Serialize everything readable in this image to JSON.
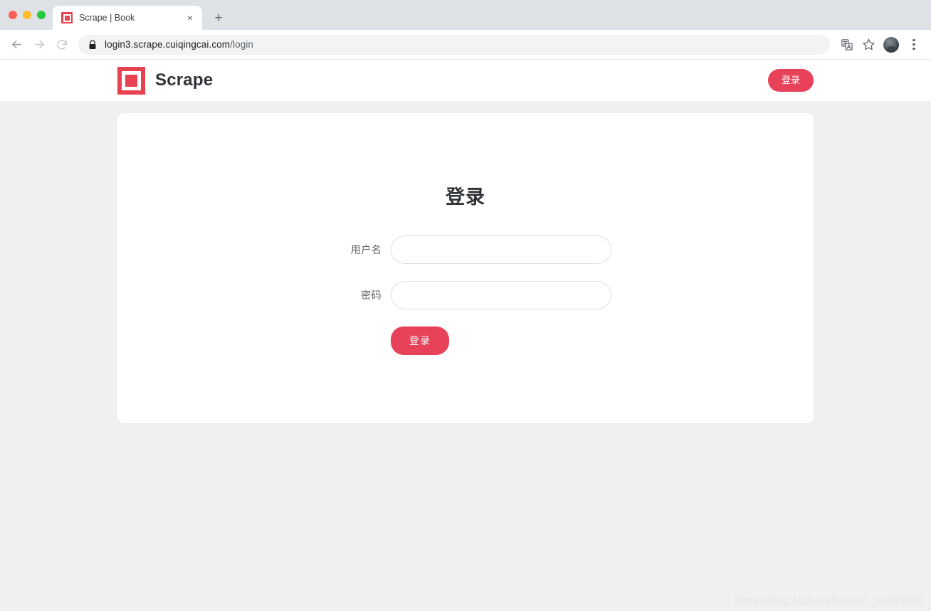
{
  "browser": {
    "window_controls": [
      "close",
      "minimize",
      "maximize"
    ],
    "tab": {
      "title": "Scrape | Book",
      "favicon": "scrape-logo-icon",
      "close_label": "×"
    },
    "new_tab_label": "+",
    "nav": {
      "back": "back-arrow-icon",
      "forward": "forward-arrow-icon",
      "reload": "reload-icon"
    },
    "omnibox": {
      "security_icon": "lock-icon",
      "url_domain": "login3.scrape.cuiqingcai.com",
      "url_path": "/login",
      "full_url": "login3.scrape.cuiqingcai.com/login"
    },
    "toolbar_icons": [
      {
        "name": "translate-icon"
      },
      {
        "name": "bookmark-star-icon"
      },
      {
        "name": "profile-avatar"
      },
      {
        "name": "chrome-menu-icon"
      }
    ]
  },
  "page": {
    "header": {
      "brand_name": "Scrape",
      "brand_mark": "scrape-logo-icon",
      "login_button": "登录"
    },
    "login_form": {
      "title": "登录",
      "fields": [
        {
          "label": "用户名",
          "value": "",
          "placeholder": "",
          "type": "text",
          "name": "username"
        },
        {
          "label": "密码",
          "value": "",
          "placeholder": "",
          "type": "password",
          "name": "password"
        }
      ],
      "submit_label": "登录"
    },
    "watermark": "https://blog.csdn.net/weixin_38819889"
  },
  "colors": {
    "brand_red": "#e8414f",
    "button_red": "#e8415a",
    "page_background": "#f0f0f2",
    "card_background": "#ffffff",
    "text_dark": "#2f3338",
    "text_muted": "#606266",
    "input_border": "#dcdfe6"
  }
}
